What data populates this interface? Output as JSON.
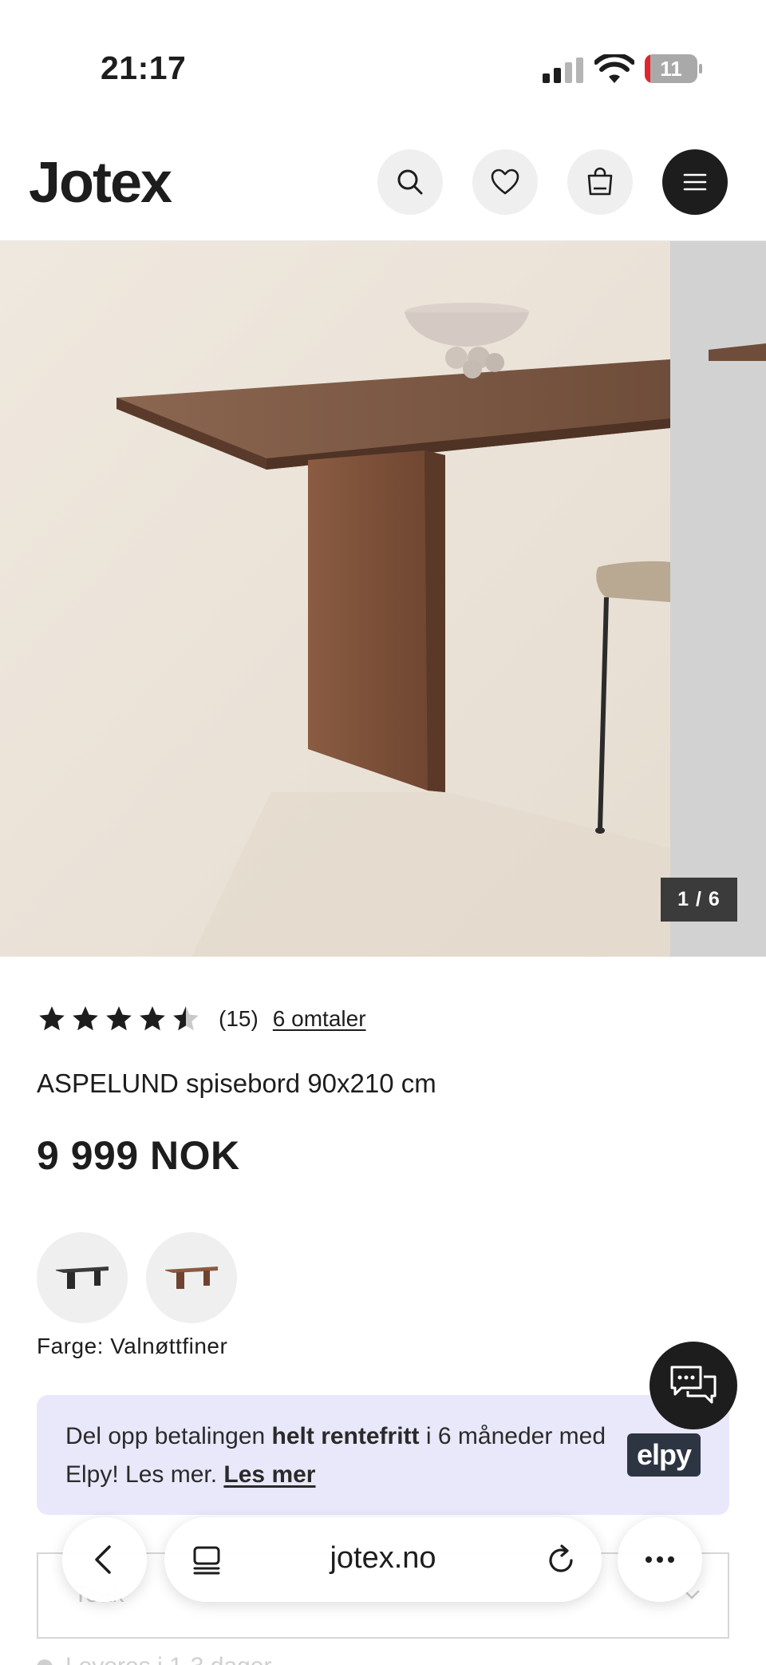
{
  "status_bar": {
    "time": "21:17",
    "battery_level": "11",
    "battery_fraction": 0.11,
    "icons": [
      "signal-icon",
      "wifi-icon",
      "battery-icon"
    ]
  },
  "header": {
    "logo": "Jotex",
    "buttons": [
      "search-icon",
      "heart-icon",
      "bag-icon",
      "menu-icon"
    ]
  },
  "gallery": {
    "counter": "1 / 6",
    "current": 1,
    "total": 6
  },
  "product": {
    "rating": 4.5,
    "rating_count": "(15)",
    "reviews_link": "6 omtaler",
    "title": "ASPELUND spisebord 90x210 cm",
    "price": "9 999 NOK",
    "swatches": [
      {
        "name": "black-table-swatch",
        "color": "#3a3a3a"
      },
      {
        "name": "walnut-table-swatch",
        "color": "#7a4a32"
      }
    ],
    "color_label": "Farge: Valnøttfiner"
  },
  "elpy": {
    "text_1": "Del opp betalingen ",
    "bold": "helt rentefritt",
    "text_2": " i 6 måneder med Elpy! Les mer. ",
    "link": "Les mer",
    "logo": "elpy"
  },
  "size_select": {
    "placeholder": "Teak"
  },
  "stock": {
    "text": "Leveres i 1-3 dager"
  },
  "browser": {
    "url": "jotex.no",
    "icons": [
      "back-icon",
      "tabs-icon",
      "reload-icon",
      "more-icon"
    ]
  },
  "colors": {
    "dark": "#1d1d1d",
    "elpy_bg": "#e9e8fb",
    "battery_red": "#e0262c"
  }
}
